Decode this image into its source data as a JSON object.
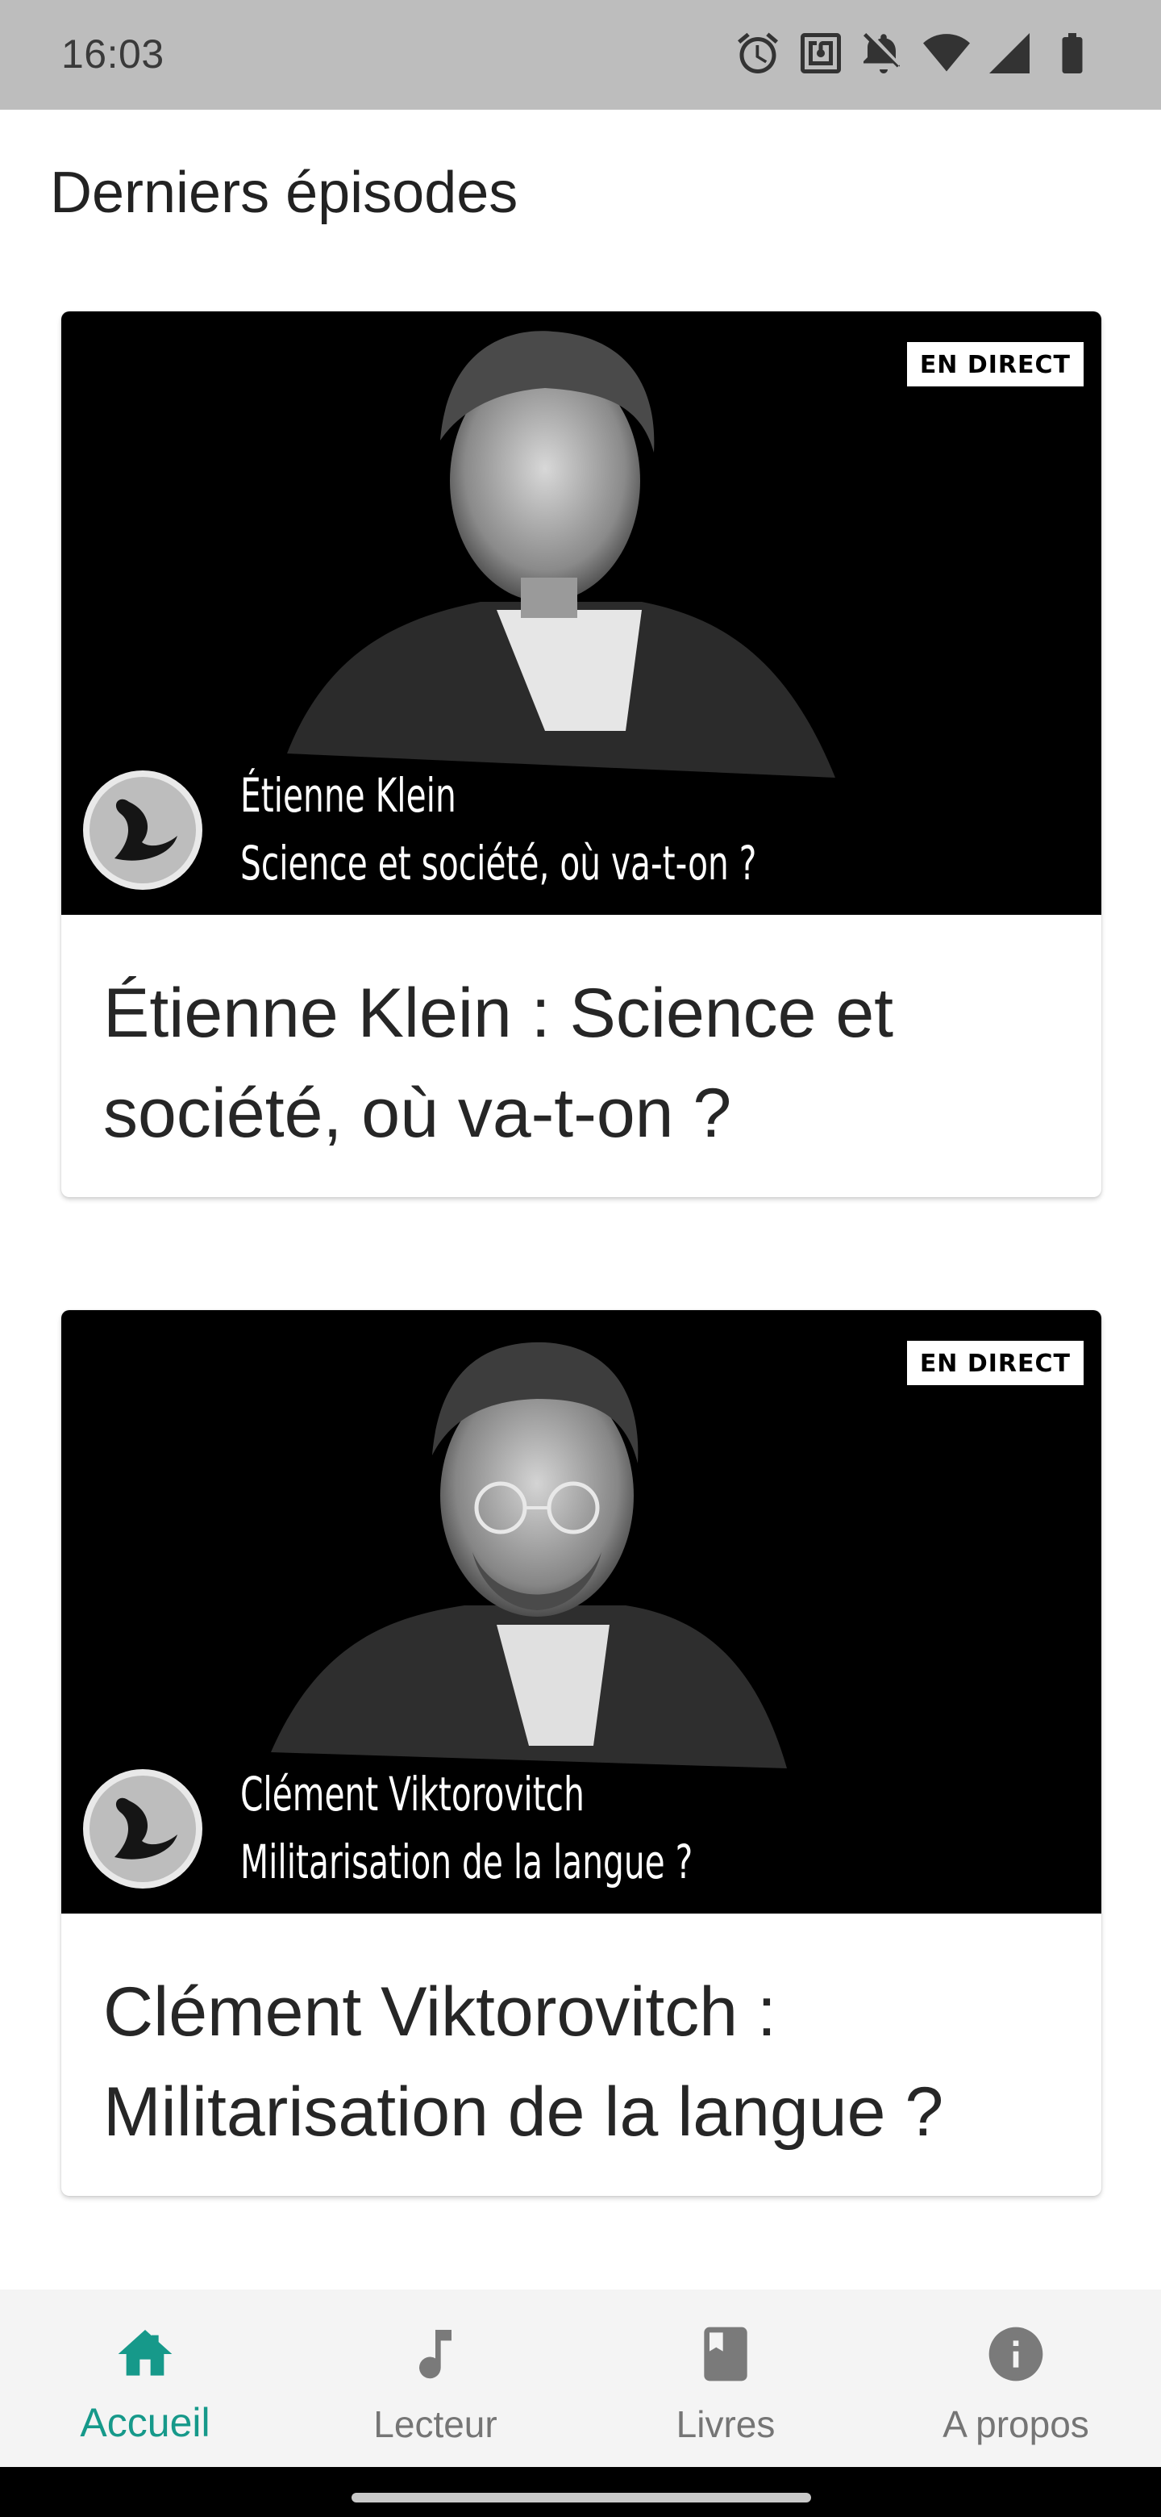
{
  "status_bar": {
    "time": "16:03",
    "icons": [
      "alarm-icon",
      "nfc-icon",
      "bell-off-icon",
      "wifi-icon",
      "signal-icon",
      "battery-icon"
    ]
  },
  "section_title": "Derniers épisodes",
  "episodes": [
    {
      "badge": "EN DIRECT",
      "thumb_name": "Étienne Klein",
      "thumb_subtitle": "Science et société, où va-t-on ?",
      "title": "Étienne Klein : Science et société, où va-t-on ?"
    },
    {
      "badge": "EN DIRECT",
      "thumb_name": "Clément Viktorovitch",
      "thumb_subtitle": "Militarisation de la langue ?",
      "title": "Clément Viktorovitch : Militarisation de la langue ?"
    }
  ],
  "bottom_nav": {
    "items": [
      {
        "label": "Accueil",
        "icon": "home-icon",
        "active": true
      },
      {
        "label": "Lecteur",
        "icon": "music-note-icon",
        "active": false
      },
      {
        "label": "Livres",
        "icon": "book-icon",
        "active": false
      },
      {
        "label": "A propos",
        "icon": "info-icon",
        "active": false
      }
    ]
  },
  "colors": {
    "accent": "#16998a",
    "status_bar": "#bdbdbd",
    "nav_bg": "#f4f4f4"
  }
}
